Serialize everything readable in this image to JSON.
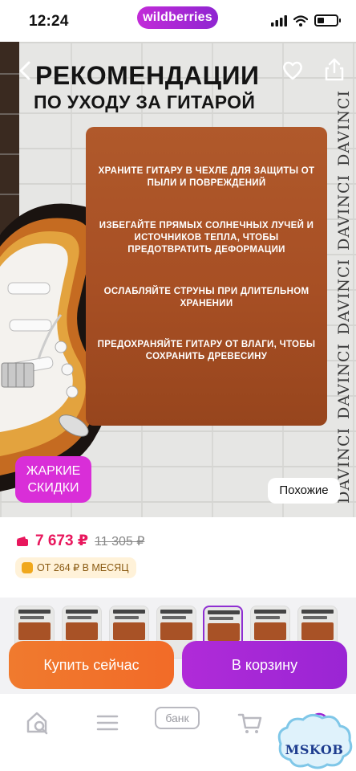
{
  "status_bar": {
    "time": "12:24",
    "brand": "wildberries",
    "battery_level": 0.35
  },
  "hero": {
    "title_line1": "РЕКОМЕНДАЦИИ",
    "title_line2": "ПО УХОДУ ЗА ГИТАРОЙ",
    "side_brand": [
      "DAVINCI",
      "DAVINCI",
      "DAVINCI",
      "DAVINCI",
      "DAVINCI"
    ],
    "tips": [
      "Храните гитару в чехле для защиты от пыли и повреждений",
      "Избегайте прямых солнечных лучей и источников тепла, чтобы предотвратить деформации",
      "Ослабляйте струны при длительном хранении",
      "Предохраняйте гитару от влаги, чтобы сохранить древесину"
    ],
    "hot_badge": "ЖАРКИЕ\nСКИДКИ",
    "hot_badge_line1": "ЖАРКИЕ",
    "hot_badge_line2": "СКИДКИ",
    "similar_label": "Похожие"
  },
  "price": {
    "current": "7 673 ₽",
    "old": "11 305 ₽",
    "installment": "ОТ 264 ₽ В МЕСЯЦ"
  },
  "thumbnails": [
    {
      "title": "ЭЛЕКТРОГИТАРА",
      "active": false
    },
    {
      "title": "гитарный",
      "active": false
    },
    {
      "title": "гитарный",
      "active": false
    },
    {
      "title": "гитарный",
      "active": false
    },
    {
      "title": "",
      "active": true
    },
    {
      "title": "ЭЛЕКТРОГИТАРА",
      "active": false
    },
    {
      "title": "гитарный",
      "active": false
    }
  ],
  "actions": {
    "buy_now": "Купить сейчас",
    "add_to_cart": "В корзину"
  },
  "bottom_nav": {
    "bank": "банк"
  },
  "watermark": "MSKOB",
  "colors": {
    "brand_purple": "#9a25d4",
    "buy_orange": "#f07a2e",
    "price_pink": "#e8175d",
    "card_brown": "#a74f24",
    "hot_badge": "#d92ed8"
  }
}
